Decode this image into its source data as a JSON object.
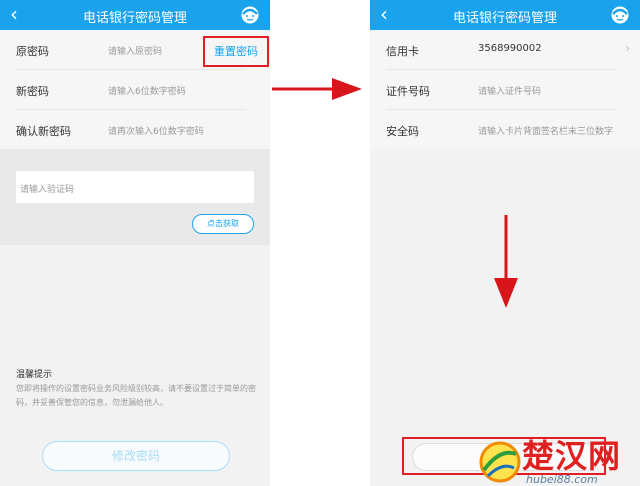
{
  "left_screen": {
    "title": "电话银行密码管理",
    "back_icon": "‹",
    "rows": [
      {
        "label": "原密码",
        "placeholder": "请输入原密码"
      },
      {
        "label": "新密码",
        "placeholder": "请输入6位数字密码"
      },
      {
        "label": "确认新密码",
        "placeholder": "请再次输入6位数字密码"
      }
    ],
    "reset_link": "重置密码",
    "verify_placeholder": "请输入验证码",
    "get_code_button": "点击获取",
    "tips_title": "温馨提示",
    "tips_text": "您即将操作的设置密码业务风险级别较高，请不要设置过于简单的密码，并妥善保管您的信息，勿泄漏给他人。",
    "submit_button": "修改密码"
  },
  "right_screen": {
    "title": "电话银行密码管理",
    "back_icon": "‹",
    "rows": [
      {
        "label": "信用卡",
        "value": "3568990002"
      },
      {
        "label": "证件号码",
        "placeholder": "请输入证件号码"
      },
      {
        "label": "安全码",
        "placeholder": "请输入卡片背面签名栏末三位数字"
      }
    ],
    "chevron": "›"
  },
  "watermark": {
    "name": "楚汉网",
    "url": "hubei88.com"
  },
  "colors": {
    "primary": "#1aa3ec",
    "highlight": "#e31b23",
    "arrow": "#d8151b"
  }
}
